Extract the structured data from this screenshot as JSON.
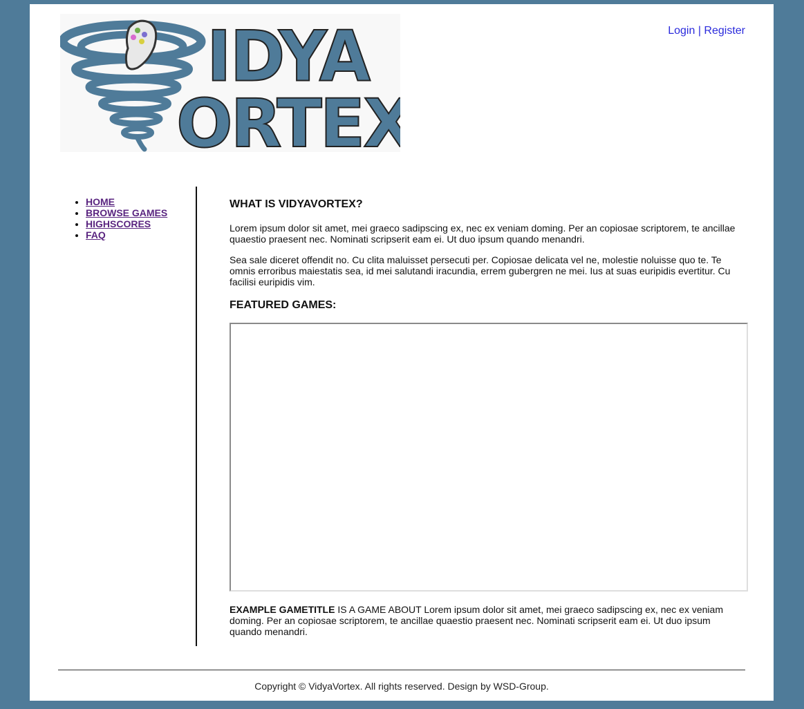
{
  "header": {
    "logo_text": "VIDYA VORTEX",
    "auth": {
      "login": "Login",
      "separator": " | ",
      "register": "Register"
    }
  },
  "nav": {
    "items": [
      {
        "label": "HOME"
      },
      {
        "label": "BROWSE GAMES"
      },
      {
        "label": "HIGHSCORES"
      },
      {
        "label": "FAQ"
      }
    ]
  },
  "main": {
    "about_heading": "WHAT IS VIDYAVORTEX?",
    "about_p1": "Lorem ipsum dolor sit amet, mei graeco sadipscing ex, nec ex veniam doming. Per an copiosae scriptorem, te ancillae quaestio praesent nec. Nominati scripserit eam ei. Ut duo ipsum quando menandri.",
    "about_p2": "Sea sale diceret offendit no. Cu clita maluisset persecuti per. Copiosae delicata vel ne, molestie noluisse quo te. Te omnis erroribus maiestatis sea, id mei salutandi iracundia, errem gubergren ne mei. Ius at suas euripidis evertitur. Cu facilisi euripidis vim.",
    "featured_heading": "FEATURED GAMES:",
    "game_title": "EXAMPLE GAMETITLE",
    "game_desc": " IS A GAME ABOUT Lorem ipsum dolor sit amet, mei graeco sadipscing ex, nec ex veniam doming. Per an copiosae scriptorem, te ancillae quaestio praesent nec. Nominati scripserit eam ei. Ut duo ipsum quando menandri."
  },
  "footer": {
    "text": "Copyright © VidyaVortex. All rights reserved. Design by WSD-Group."
  },
  "colors": {
    "background": "#4f7b99",
    "logo_blue": "#4f7b99",
    "link_blue": "#2a2adc",
    "nav_visited": "#5a2580"
  }
}
